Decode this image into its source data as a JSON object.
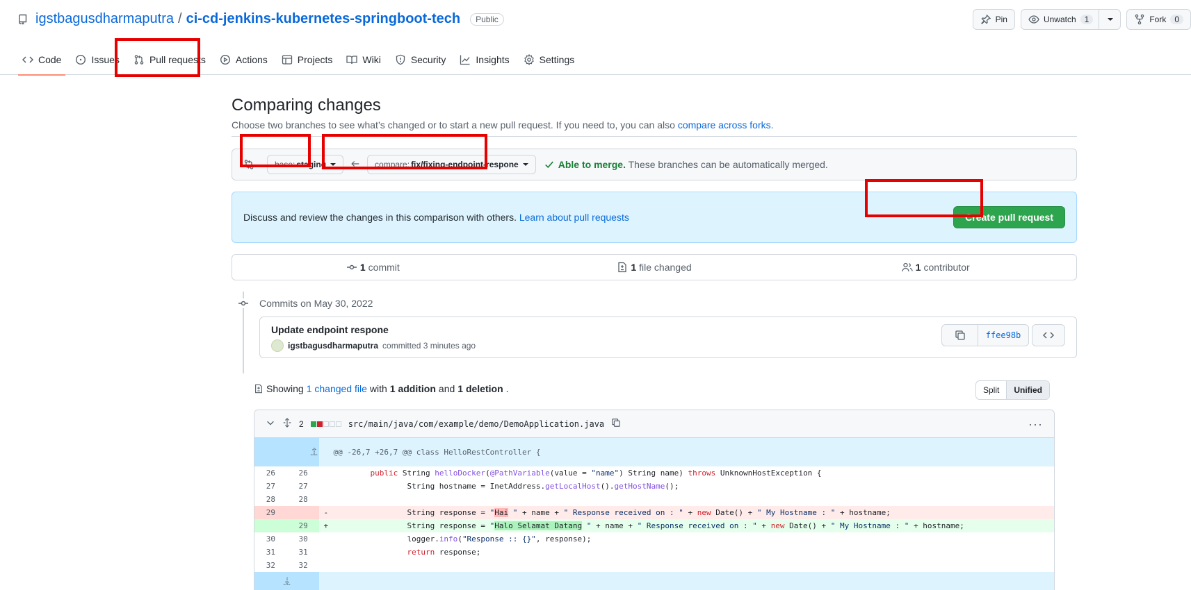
{
  "repo": {
    "owner": "igstbagusdharmaputra",
    "separator": "/",
    "name": "ci-cd-jenkins-kubernetes-springboot-tech",
    "visibility": "Public"
  },
  "header_actions": {
    "pin": "Pin",
    "unwatch": "Unwatch",
    "unwatch_count": "1",
    "fork": "Fork",
    "fork_count": "0"
  },
  "nav": {
    "code": "Code",
    "issues": "Issues",
    "pull_requests": "Pull requests",
    "actions": "Actions",
    "projects": "Projects",
    "wiki": "Wiki",
    "security": "Security",
    "insights": "Insights",
    "settings": "Settings"
  },
  "compare": {
    "title": "Comparing changes",
    "subtitle": "Choose two branches to see what’s changed or to start a new pull request. If you need to, you can also ",
    "subtitle_link": "compare across forks",
    "subtitle_end": ".",
    "base_label": "base: ",
    "base_branch": "staging",
    "compare_label": "compare: ",
    "compare_branch": "fix/fixing-endpoint-respone",
    "merge_status": "Able to merge.",
    "merge_text": " These branches can be automatically merged."
  },
  "discuss": {
    "text": "Discuss and review the changes in this comparison with others. ",
    "link": "Learn about pull requests",
    "button": "Create pull request"
  },
  "stats": {
    "commits_count": "1",
    "commits_label": "commit",
    "files_count": "1",
    "files_label": "file changed",
    "contributors_count": "1",
    "contributors_label": "contributor"
  },
  "commits": {
    "date": "Commits on May 30, 2022",
    "message": "Update endpoint respone",
    "author": "igstbagusdharmaputra",
    "meta": "committed 3 minutes ago",
    "sha": "ffee98b"
  },
  "summary": {
    "showing": "Showing ",
    "changed_link": "1 changed file",
    "with": " with ",
    "additions": "1 addition",
    "and": " and ",
    "deletions": "1 deletion",
    "end": ".",
    "split": "Split",
    "unified": "Unified"
  },
  "file": {
    "change_count": "2",
    "path": "src/main/java/com/example/demo/DemoApplication.java",
    "hunk": "@@ -26,7 +26,7 @@ class HelloRestController {"
  },
  "diff_lines": [
    {
      "old": "26",
      "new": "26",
      "sign": "",
      "type": "ctx",
      "indent": "        ",
      "parts": [
        [
          "kw",
          "public"
        ],
        [
          "",
          " String "
        ],
        [
          "fn",
          "helloDocker"
        ],
        [
          "",
          "("
        ],
        [
          "fn",
          "@PathVariable"
        ],
        [
          "",
          "(value = "
        ],
        [
          "str",
          "\"name\""
        ],
        [
          "",
          ") String name) "
        ],
        [
          "kw",
          "throws"
        ],
        [
          "",
          " UnknownHostException {"
        ]
      ]
    },
    {
      "old": "27",
      "new": "27",
      "sign": "",
      "type": "ctx",
      "indent": "                ",
      "parts": [
        [
          "",
          "String hostname = InetAddress."
        ],
        [
          "fn",
          "getLocalHost"
        ],
        [
          "",
          "()."
        ],
        [
          "fn",
          "getHostName"
        ],
        [
          "",
          "();"
        ]
      ]
    },
    {
      "old": "28",
      "new": "28",
      "sign": "",
      "type": "ctx",
      "indent": "",
      "parts": []
    },
    {
      "old": "29",
      "new": "",
      "sign": "-",
      "type": "del",
      "indent": "                ",
      "parts": [
        [
          "",
          "String response = "
        ],
        [
          "str",
          "\""
        ],
        [
          "mdel",
          "Hai"
        ],
        [
          "str",
          " \""
        ],
        [
          "",
          " + name + "
        ],
        [
          "str",
          "\" Response received on : \""
        ],
        [
          "",
          " + "
        ],
        [
          "kw",
          "new"
        ],
        [
          "",
          " Date() + "
        ],
        [
          "str",
          "\" My Hostname : \""
        ],
        [
          "",
          " + hostname;"
        ]
      ]
    },
    {
      "old": "",
      "new": "29",
      "sign": "+",
      "type": "add",
      "indent": "                ",
      "parts": [
        [
          "",
          "String response = "
        ],
        [
          "str",
          "\""
        ],
        [
          "madd",
          "Halo Selamat Datang"
        ],
        [
          "str",
          " \""
        ],
        [
          "",
          " + name + "
        ],
        [
          "str",
          "\" Response received on : \""
        ],
        [
          "",
          " + "
        ],
        [
          "kw",
          "new"
        ],
        [
          "",
          " Date() + "
        ],
        [
          "str",
          "\" My Hostname : \""
        ],
        [
          "",
          " + hostname;"
        ]
      ]
    },
    {
      "old": "30",
      "new": "30",
      "sign": "",
      "type": "ctx",
      "indent": "                ",
      "parts": [
        [
          "",
          "logger."
        ],
        [
          "fn",
          "info"
        ],
        [
          "",
          "("
        ],
        [
          "str",
          "\"Response :: {}\""
        ],
        [
          "",
          ", response);"
        ]
      ]
    },
    {
      "old": "31",
      "new": "31",
      "sign": "",
      "type": "ctx",
      "indent": "                ",
      "parts": [
        [
          "kw",
          "return"
        ],
        [
          "",
          " response;"
        ]
      ]
    },
    {
      "old": "32",
      "new": "32",
      "sign": "",
      "type": "ctx",
      "indent": "",
      "parts": []
    }
  ],
  "colors": {
    "accent": "#0969da",
    "success": "#2da44e",
    "highlight": "#e60000"
  }
}
